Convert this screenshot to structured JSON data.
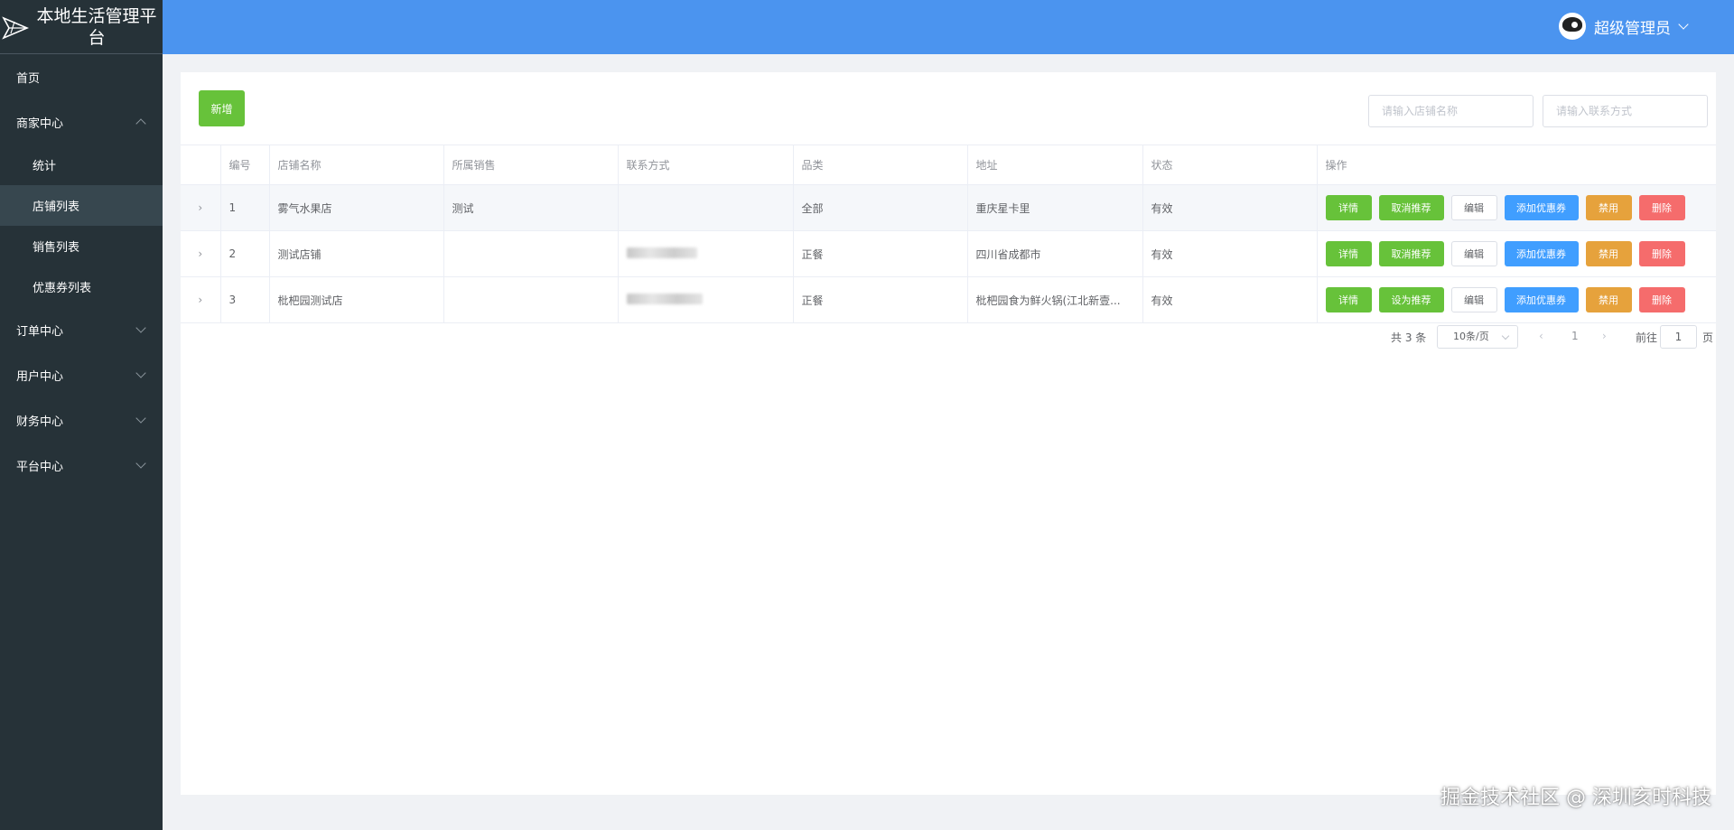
{
  "app": {
    "title": "本地生活管理平台"
  },
  "header": {
    "user": "超级管理员"
  },
  "sidebar": {
    "items": [
      {
        "label": "首页"
      },
      {
        "label": "商家中心",
        "subs": [
          {
            "label": "统计"
          },
          {
            "label": "店铺列表"
          },
          {
            "label": "销售列表"
          },
          {
            "label": "优惠券列表"
          }
        ]
      },
      {
        "label": "订单中心"
      },
      {
        "label": "用户中心"
      },
      {
        "label": "财务中心"
      },
      {
        "label": "平台中心"
      }
    ]
  },
  "toolbar": {
    "add_label": "新增",
    "search_name_placeholder": "请输入店铺名称",
    "search_contact_placeholder": "请输入联系方式"
  },
  "table": {
    "headers": [
      "编号",
      "店铺名称",
      "所属销售",
      "联系方式",
      "品类",
      "地址",
      "状态",
      "操作"
    ],
    "rows": [
      {
        "id": "1",
        "name": "雾气水果店",
        "sales": "测试",
        "contact": "",
        "category": "全部",
        "address": "重庆星卡里",
        "status": "有效",
        "recommend": "取消推荐"
      },
      {
        "id": "2",
        "name": "测试店铺",
        "sales": "",
        "contact": "",
        "category": "正餐",
        "address": "四川省成都市",
        "status": "有效",
        "recommend": "取消推荐"
      },
      {
        "id": "3",
        "name": "枇杷园测试店",
        "sales": "",
        "contact": "",
        "category": "正餐",
        "address": "枇杷园食为鲜火锅(江北新壹...",
        "status": "有效",
        "recommend": "设为推荐"
      }
    ],
    "actions": {
      "detail": "详情",
      "edit": "编辑",
      "add_coupon": "添加优惠券",
      "disable": "禁用",
      "delete": "删除"
    }
  },
  "pagination": {
    "total": "共 3 条",
    "page_size": "10条/页",
    "current": "1",
    "goto_label": "前往",
    "goto_value": "1",
    "page_suffix": "页"
  },
  "watermark": "掘金技术社区 @ 深圳亥时科技"
}
